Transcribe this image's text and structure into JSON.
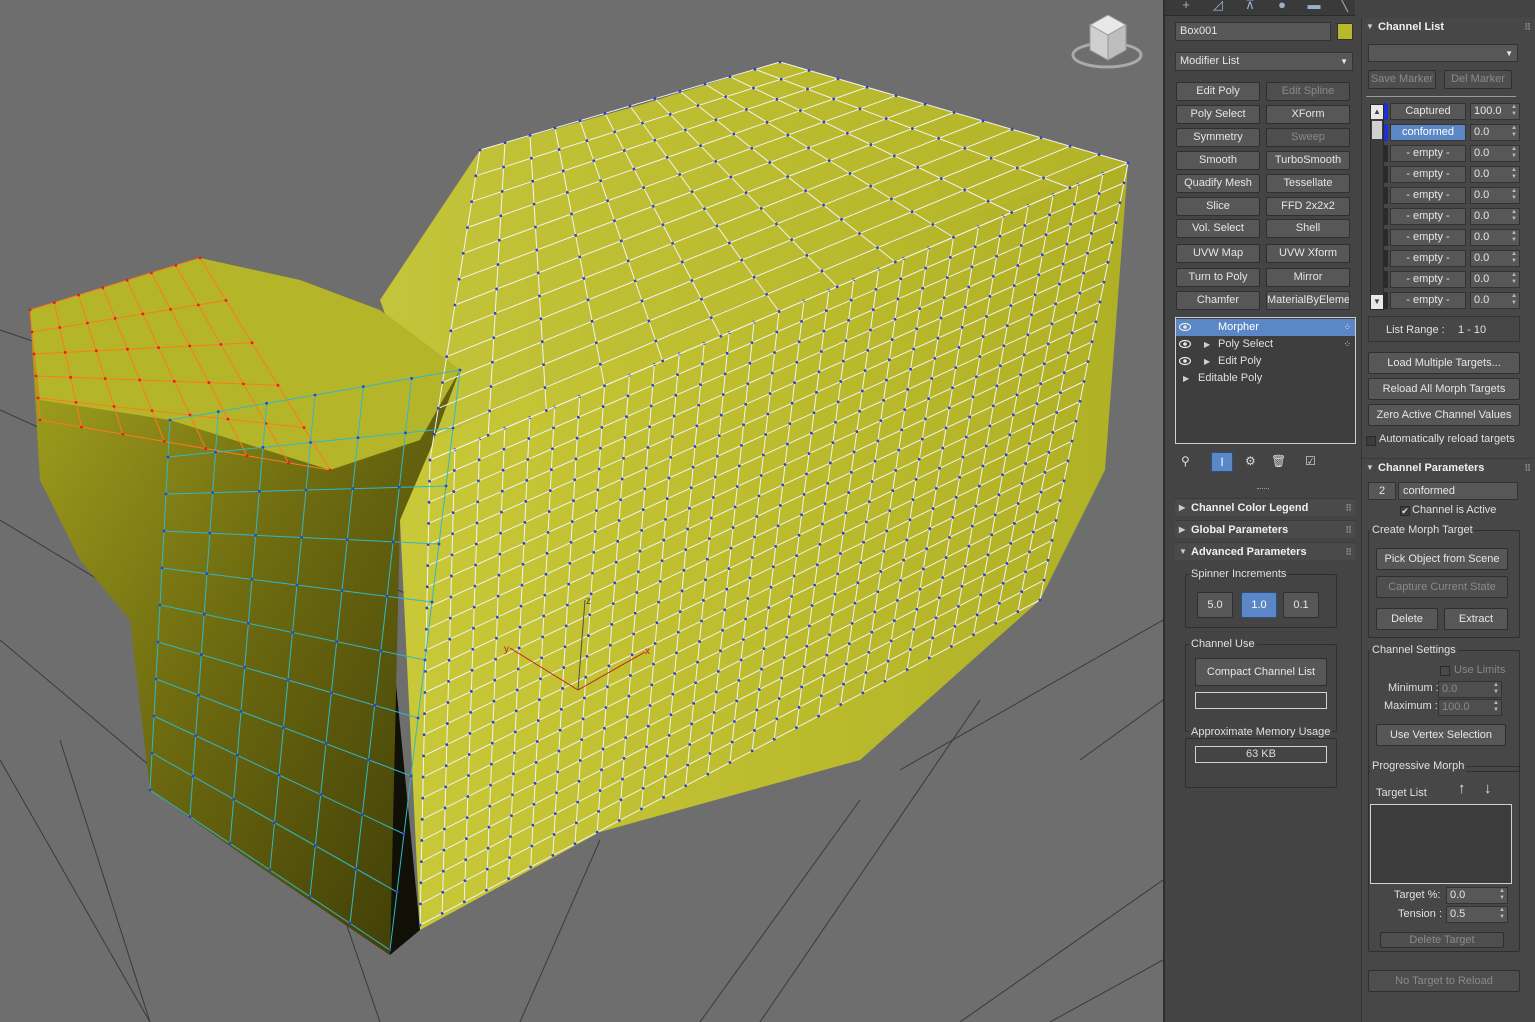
{
  "object": {
    "name": "Box001",
    "color": "#b8b82a"
  },
  "modifier_list": {
    "label": "Modifier List"
  },
  "modifier_buttons": [
    [
      "Edit Poly",
      "Edit Spline"
    ],
    [
      "Poly Select",
      "XForm"
    ],
    [
      "Symmetry",
      "Sweep"
    ],
    [
      "Smooth",
      "TurboSmooth"
    ],
    [
      "Quadify Mesh",
      "Tessellate"
    ],
    [
      "Slice",
      "FFD 2x2x2"
    ],
    [
      "Vol. Select",
      "Shell"
    ],
    [
      "UVW Map",
      "UVW Xform"
    ],
    [
      "Turn to Poly",
      "Mirror"
    ],
    [
      "Chamfer",
      "MaterialByElement"
    ]
  ],
  "modifier_stack": [
    "Morpher",
    "Poly Select",
    "Edit Poly",
    "Editable Poly"
  ],
  "rollouts": {
    "channel_color_legend": "Channel Color Legend",
    "global_parameters": "Global Parameters",
    "advanced_parameters": "Advanced Parameters"
  },
  "advanced": {
    "spinner_increments_label": "Spinner Increments",
    "increments": [
      "5.0",
      "1.0",
      "0.1"
    ],
    "channel_use_label": "Channel Use",
    "compact_button": "Compact Channel List",
    "memory_label": "Approximate Memory Usage",
    "memory_value": "63 KB"
  },
  "channel_list": {
    "title": "Channel List",
    "save_marker": "Save Marker",
    "del_marker": "Del Marker",
    "channels": [
      {
        "name": "Captured",
        "value": "100.0"
      },
      {
        "name": "conformed",
        "value": "0.0"
      },
      {
        "name": "- empty -",
        "value": "0.0"
      },
      {
        "name": "- empty -",
        "value": "0.0"
      },
      {
        "name": "- empty -",
        "value": "0.0"
      },
      {
        "name": "- empty -",
        "value": "0.0"
      },
      {
        "name": "- empty -",
        "value": "0.0"
      },
      {
        "name": "- empty -",
        "value": "0.0"
      },
      {
        "name": "- empty -",
        "value": "0.0"
      },
      {
        "name": "- empty -",
        "value": "0.0"
      }
    ],
    "list_range_label": "List Range :",
    "list_range_value": "1 - 10",
    "load_multiple": "Load Multiple Targets...",
    "reload_all": "Reload All Morph Targets",
    "zero_active": "Zero Active Channel Values",
    "auto_reload": "Automatically reload targets"
  },
  "channel_parameters": {
    "title": "Channel Parameters",
    "number": "2",
    "name": "conformed",
    "is_active": "Channel is Active",
    "create_target_label": "Create Morph Target",
    "pick_object": "Pick Object from Scene",
    "capture_state": "Capture Current State",
    "delete": "Delete",
    "extract": "Extract",
    "channel_settings_label": "Channel Settings",
    "use_limits": "Use Limits",
    "minimum_label": "Minimum :",
    "minimum_value": "0.0",
    "maximum_label": "Maximum :",
    "maximum_value": "100.0",
    "use_vertex_selection": "Use Vertex Selection",
    "progressive_label": "Progressive Morph",
    "target_list_label": "Target List",
    "target_pct_label": "Target %:",
    "target_pct_value": "0.0",
    "tension_label": "Tension :",
    "tension_value": "0.5",
    "delete_target": "Delete Target",
    "no_target": "No Target to Reload"
  },
  "colors": {
    "accent": "#5b87c6",
    "mesh": "#b8b82a",
    "viewport": "#6e6e6e"
  },
  "gizmo_axes": {
    "x": "x",
    "y": "y",
    "z": "z"
  }
}
